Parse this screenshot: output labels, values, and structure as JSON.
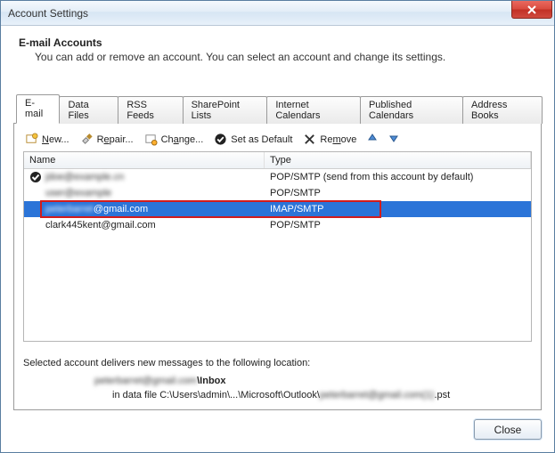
{
  "window": {
    "title": "Account Settings"
  },
  "heading": {
    "title": "E-mail Accounts",
    "subtitle": "You can add or remove an account. You can select an account and change its settings."
  },
  "tabs": [
    {
      "label": "E-mail",
      "active": true
    },
    {
      "label": "Data Files"
    },
    {
      "label": "RSS Feeds"
    },
    {
      "label": "SharePoint Lists"
    },
    {
      "label": "Internet Calendars"
    },
    {
      "label": "Published Calendars"
    },
    {
      "label": "Address Books"
    }
  ],
  "toolbar": {
    "new": "New...",
    "repair": "Repair...",
    "change": "Change...",
    "setdefault": "Set as Default",
    "remove": "Remove"
  },
  "list": {
    "columns": {
      "name": "Name",
      "type": "Type"
    },
    "rows": [
      {
        "name": "jdoe@example.cn",
        "type": "POP/SMTP (send from this account by default)",
        "default": true,
        "blurName": true
      },
      {
        "name": "user@example",
        "type": "POP/SMTP",
        "blurName": true
      },
      {
        "name": "peterbarret@gmail.com",
        "type": "IMAP/SMTP",
        "selected": true,
        "blurPartial": true,
        "highlight": true
      },
      {
        "name": "clark445kent@gmail.com",
        "type": "POP/SMTP"
      }
    ]
  },
  "location": {
    "intro": "Selected account delivers new messages to the following location:",
    "line1_blur": "peterbarret@gmail.com",
    "line1_bold": "\\Inbox",
    "line2_prefix": "in data file C:\\Users\\admin\\...\\Microsoft\\Outlook\\",
    "line2_blur": "peterbarret@gmail.com(1)",
    "line2_suffix": ".pst"
  },
  "footer": {
    "close": "Close"
  }
}
